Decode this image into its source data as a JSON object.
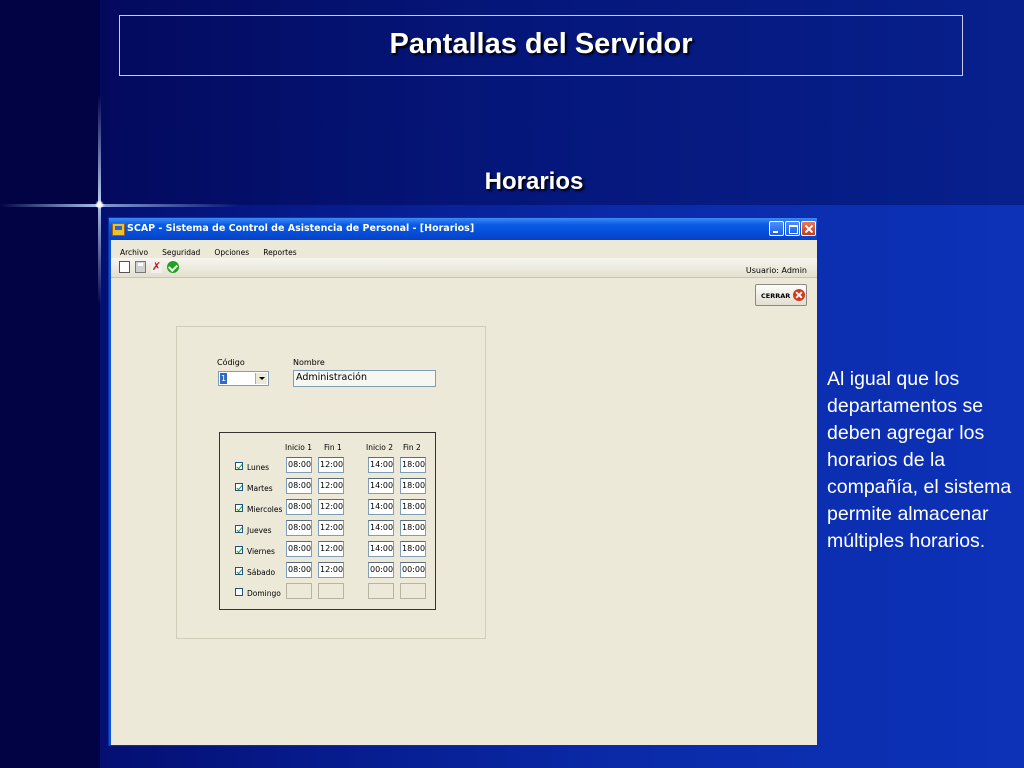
{
  "slide": {
    "title": "Pantallas del Servidor",
    "subtitle": "Horarios",
    "description": "Al igual que los departamentos se deben agregar los horarios de la compañía, el sistema permite almacenar múltiples horarios."
  },
  "window": {
    "title": "SCAP - Sistema de Control de Asistencia de Personal - [Horarios]",
    "menu": [
      "Archivo",
      "Seguridad",
      "Opciones",
      "Reportes"
    ],
    "user_label": "Usuario: Admin",
    "close_button": "CERRAR"
  },
  "form": {
    "codigo_label": "Código",
    "codigo_value": "1",
    "nombre_label": "Nombre",
    "nombre_value": "Administración",
    "headers": [
      "Inicio 1",
      "Fin 1",
      "Inicio 2",
      "Fin 2"
    ],
    "days": [
      {
        "name": "Lunes",
        "checked": true,
        "inicio1": "08:00",
        "fin1": "12:00",
        "inicio2": "14:00",
        "fin2": "18:00"
      },
      {
        "name": "Martes",
        "checked": true,
        "inicio1": "08:00",
        "fin1": "12:00",
        "inicio2": "14:00",
        "fin2": "18:00"
      },
      {
        "name": "Miercoles",
        "checked": true,
        "inicio1": "08:00",
        "fin1": "12:00",
        "inicio2": "14:00",
        "fin2": "18:00"
      },
      {
        "name": "Jueves",
        "checked": true,
        "inicio1": "08:00",
        "fin1": "12:00",
        "inicio2": "14:00",
        "fin2": "18:00"
      },
      {
        "name": "Viernes",
        "checked": true,
        "inicio1": "08:00",
        "fin1": "12:00",
        "inicio2": "14:00",
        "fin2": "18:00"
      },
      {
        "name": "Sábado",
        "checked": true,
        "inicio1": "08:00",
        "fin1": "12:00",
        "inicio2": "00:00",
        "fin2": "00:00"
      },
      {
        "name": "Domingo",
        "checked": false,
        "inicio1": "",
        "fin1": "",
        "inicio2": "",
        "fin2": ""
      }
    ]
  },
  "colors": {
    "background": "#0a2aa8",
    "window_titlebar": "#0a5ce6",
    "form_background": "#ece9d8"
  }
}
